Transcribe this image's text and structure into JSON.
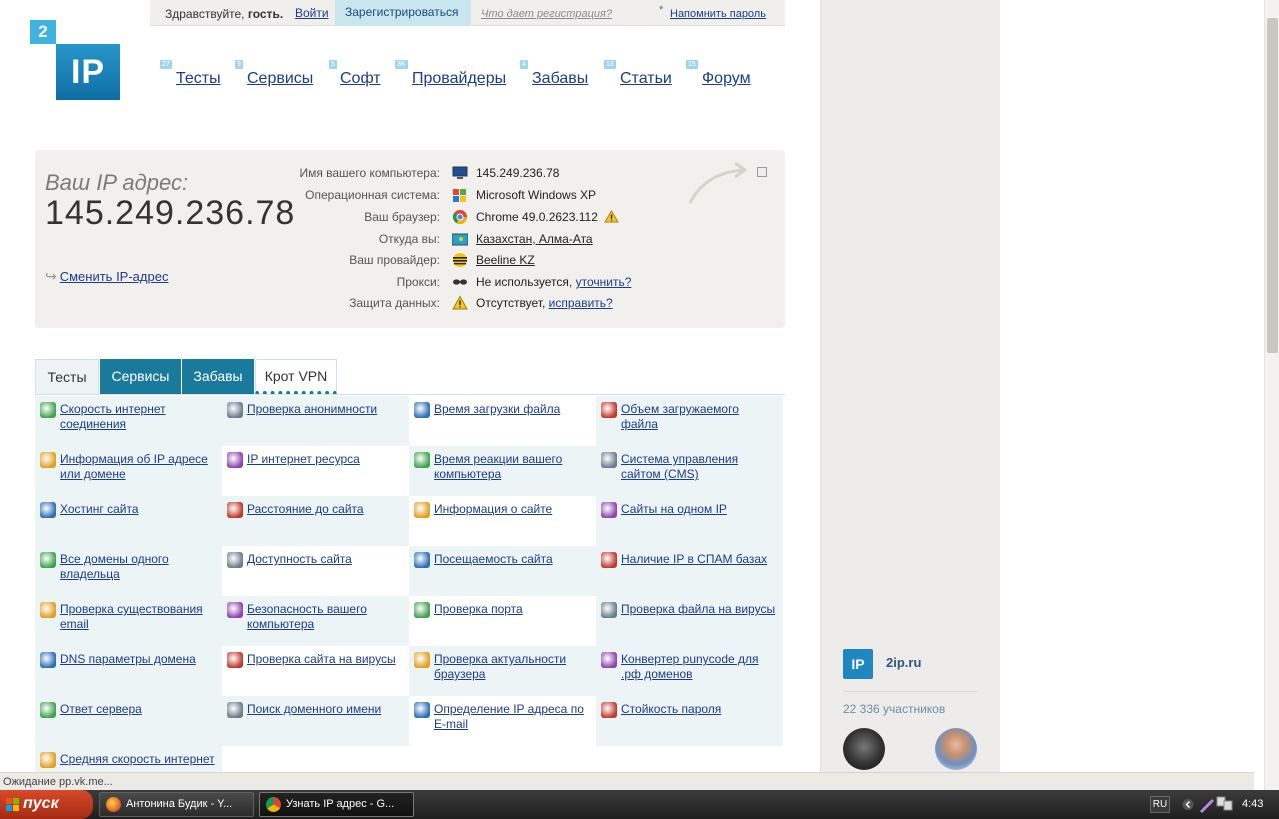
{
  "top_bar": {
    "greeting": "Здравствуйте,",
    "guest": "гость.",
    "login": "Войти",
    "register": "Зарегистрироваться",
    "what_gives": "Что дает регистрация?",
    "star": "*",
    "remind_password": "Напомнить пароль"
  },
  "logo": {
    "small": "2",
    "big": "IP"
  },
  "nav": [
    {
      "badge": "27",
      "label": "Тесты"
    },
    {
      "badge": "9",
      "label": "Сервисы"
    },
    {
      "badge": "5",
      "label": "Софт"
    },
    {
      "badge": "3K",
      "label": "Провайдеры"
    },
    {
      "badge": "4",
      "label": "Забавы"
    },
    {
      "badge": "13",
      "label": "Статьи"
    },
    {
      "badge": "15",
      "label": "Форум"
    }
  ],
  "ip_panel": {
    "caption": "Ваш IP адрес:",
    "ip": "145.249.236.78",
    "change_ip": "Сменить IP-адрес",
    "rows": [
      {
        "label": "Имя вашего компьютера:",
        "icon": "computer-icon",
        "value": "145.249.236.78"
      },
      {
        "label": "Операционная система:",
        "icon": "windows-icon",
        "value": "Microsoft Windows XP"
      },
      {
        "label": "Ваш браузер:",
        "icon": "chrome-icon",
        "value": "Chrome 49.0.2623.112",
        "warn": true
      },
      {
        "label": "Откуда вы:",
        "icon": "kazakhstan-flag-icon",
        "value": "Казахстан, Алма-Ата",
        "link": true
      },
      {
        "label": "Ваш провайдер:",
        "icon": "beeline-icon",
        "value": "Beeline KZ",
        "link": true
      },
      {
        "label": "Прокси:",
        "icon": "sunglasses-icon",
        "value": "Не используется,",
        "extra": "уточнить?"
      },
      {
        "label": "Защита данных:",
        "icon": "warning-icon",
        "value": "Отсутствует,",
        "extra": "исправить?"
      }
    ]
  },
  "tabs": [
    "Тесты",
    "Сервисы",
    "Забавы",
    "Крот VPN"
  ],
  "services": [
    [
      "Скорость интернет соединения",
      "Проверка анонимности",
      "Время загрузки файла",
      "Объем загружаемого файла"
    ],
    [
      "Информация об IP адресе или домене",
      "IP интернет ресурса",
      "Время реакции вашего компьютера",
      "Система управления сайтом (CMS)"
    ],
    [
      "Хостинг сайта",
      "Расстояние до сайта",
      "Информация о сайте",
      "Сайты на одном IP"
    ],
    [
      "Все домены одного владельца",
      "Доступность сайта",
      "Посещаемость сайта",
      "Наличие IP в СПАМ базах"
    ],
    [
      "Проверка существования email",
      "Безопасность вашего компьютера",
      "Проверка порта",
      "Проверка файла на вирусы"
    ],
    [
      "DNS параметры домена",
      "Проверка сайта на вирусы",
      "Проверка актуальности браузера",
      "Конвертер punycode для .рф доменов"
    ],
    [
      "Ответ сервера",
      "Поиск доменного имени",
      "Определение IP адреса по E-mail",
      "Стойкость пароля"
    ],
    [
      "Средняя скорость интернет"
    ]
  ],
  "vk_widget": {
    "logo": "IP",
    "name": "2ip.ru",
    "members": "22 336 участников"
  },
  "status_bar": {
    "text": "Ожидание pp.vk.me..."
  },
  "taskbar": {
    "start": "пуск",
    "tasks": [
      "Антонина Будик - Y...",
      "Узнать IP адрес - G..."
    ],
    "lang": "RU",
    "clock": "4:43"
  }
}
